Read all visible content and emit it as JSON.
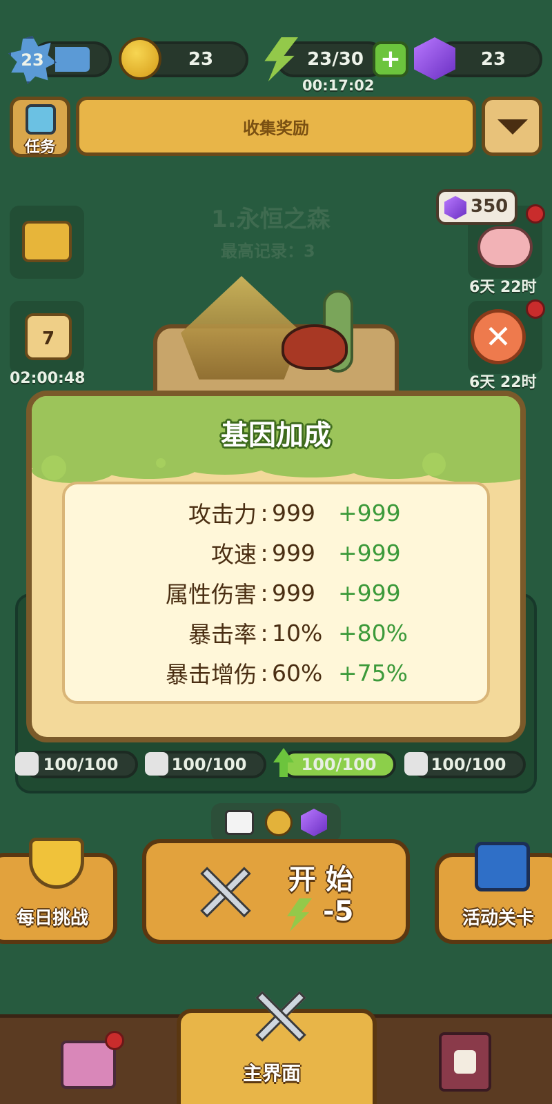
{
  "top_bar": {
    "level": "23",
    "leaves": "23",
    "energy": "23/30",
    "energy_timer": "00:17:02",
    "gems": "23"
  },
  "quest_button_label": "任务",
  "banner_label": "收集奖励",
  "stage": {
    "title": "1.永恒之森",
    "best_record": "最高记录：3"
  },
  "side_left": {
    "calendar_day": "7",
    "calendar_timer": "02:00:48"
  },
  "side_right": {
    "piggy_gems": "350",
    "piggy_timer": "6天 22时",
    "offer_timer": "6天 22时"
  },
  "dialog": {
    "title": "基因加成",
    "stats": [
      {
        "label": "攻击力",
        "value": "999",
        "bonus": "+999"
      },
      {
        "label": "攻速",
        "value": "999",
        "bonus": "+999"
      },
      {
        "label": "属性伤害",
        "value": "999",
        "bonus": "+999"
      },
      {
        "label": "暴击率",
        "value": "10%",
        "bonus": "+80%"
      },
      {
        "label": "暴击增伤",
        "value": "60%",
        "bonus": "+75%"
      }
    ]
  },
  "cards": [
    "100/100",
    "100/100",
    "100/100",
    "100/100"
  ],
  "actions": {
    "daily_label": "每日挑战",
    "start_label": "开 始",
    "start_cost": "-5",
    "event_label": "活动关卡"
  },
  "nav": {
    "main_label": "主界面"
  },
  "colors": {
    "background": "#275b3f",
    "dialog_header": "#9cc45a",
    "bonus_green": "#3c9a3a"
  }
}
